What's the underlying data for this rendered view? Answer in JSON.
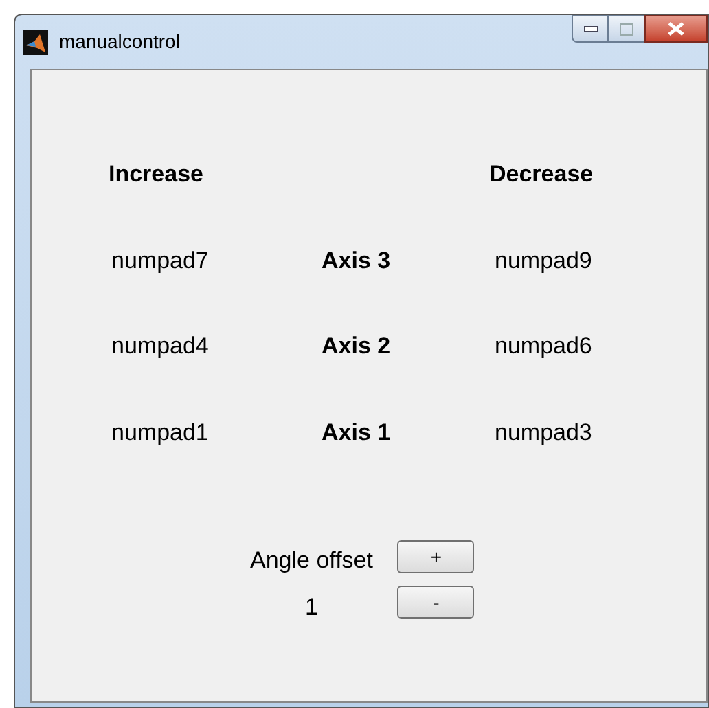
{
  "window": {
    "title": "manualcontrol"
  },
  "headers": {
    "increase": "Increase",
    "decrease": "Decrease"
  },
  "rows": [
    {
      "increase_key": "numpad7",
      "axis": "Axis 3",
      "decrease_key": "numpad9"
    },
    {
      "increase_key": "numpad4",
      "axis": "Axis 2",
      "decrease_key": "numpad6"
    },
    {
      "increase_key": "numpad1",
      "axis": "Axis 1",
      "decrease_key": "numpad3"
    }
  ],
  "angle_offset": {
    "label": "Angle offset",
    "value": "1",
    "buttons": [
      "+",
      "-"
    ]
  }
}
